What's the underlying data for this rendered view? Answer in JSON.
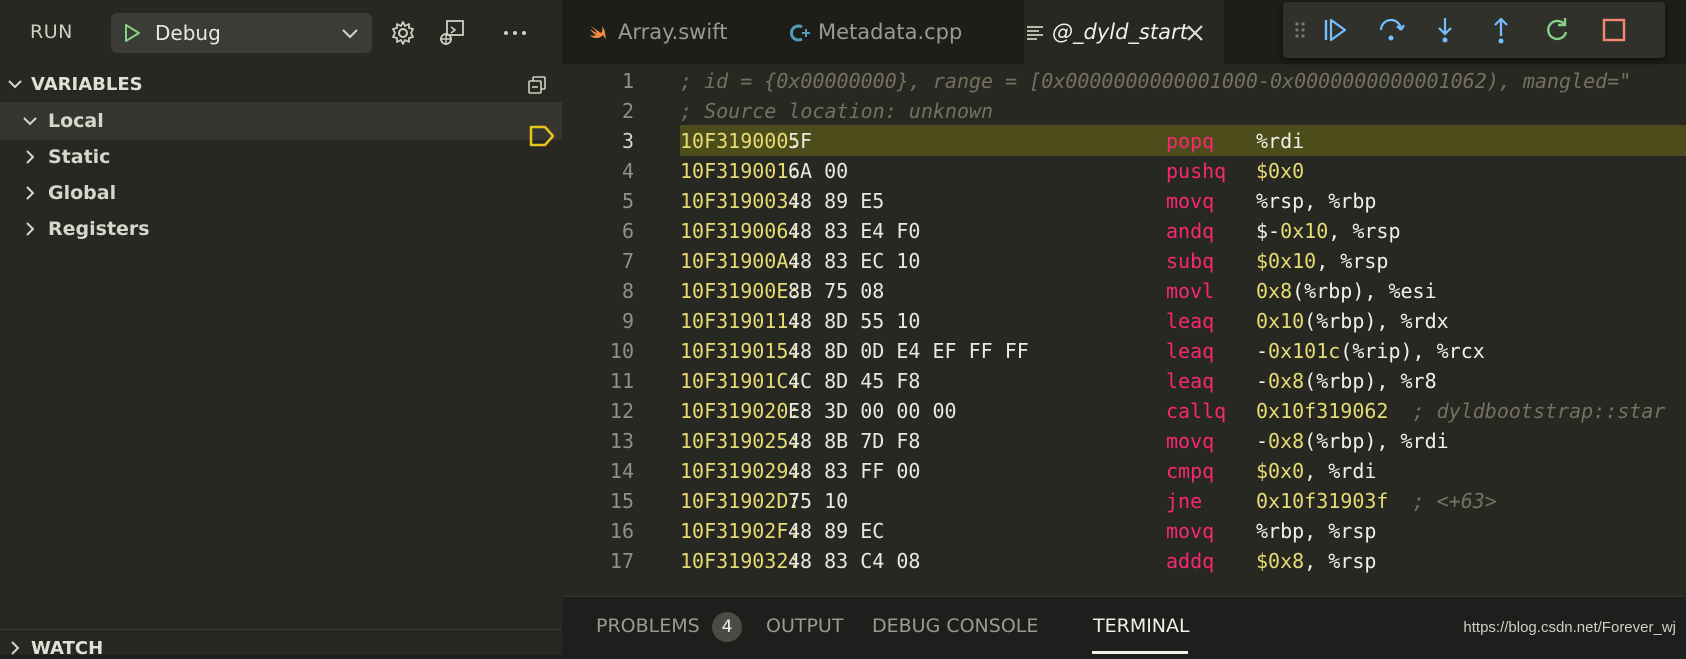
{
  "run": {
    "label": "RUN",
    "config": "Debug"
  },
  "variables": {
    "title": "VARIABLES",
    "items": [
      {
        "label": "Local",
        "expanded": true
      },
      {
        "label": "Static",
        "expanded": false
      },
      {
        "label": "Global",
        "expanded": false
      },
      {
        "label": "Registers",
        "expanded": false
      }
    ]
  },
  "watch": {
    "title": "WATCH"
  },
  "tabs": [
    {
      "label": "Array.swift",
      "icon": "swift-icon"
    },
    {
      "label": "Metadata.cpp",
      "icon": "cpp-icon"
    },
    {
      "label": "@_dyld_start",
      "icon": "disassembly-icon",
      "active": true
    }
  ],
  "debug_toolbar": [
    "continue-icon",
    "step-over-icon",
    "step-into-icon",
    "step-out-icon",
    "restart-icon",
    "stop-icon"
  ],
  "code": {
    "line1": "; id = {0x00000000}, range = [0x0000000000001000-0x0000000000001062), mangled=\"",
    "line2": "; Source location: unknown",
    "current_line": 3,
    "instructions": [
      {
        "n": "3",
        "addr": "10F319000:",
        "bytes": "5F",
        "op": "popq",
        "args": [
          {
            "t": "%rdi",
            "c": ""
          }
        ]
      },
      {
        "n": "4",
        "addr": "10F319001:",
        "bytes": "6A 00",
        "op": "pushq",
        "args": [
          {
            "t": "$0x0",
            "c": "lit"
          }
        ]
      },
      {
        "n": "5",
        "addr": "10F319003:",
        "bytes": "48 89 E5",
        "op": "movq",
        "args": [
          {
            "t": "%rsp, %rbp",
            "c": ""
          }
        ]
      },
      {
        "n": "6",
        "addr": "10F319006:",
        "bytes": "48 83 E4 F0",
        "op": "andq",
        "args": [
          {
            "t": "$-",
            "c": ""
          },
          {
            "t": "0x10",
            "c": "lit"
          },
          {
            "t": ", %rsp",
            "c": ""
          }
        ]
      },
      {
        "n": "7",
        "addr": "10F31900A:",
        "bytes": "48 83 EC 10",
        "op": "subq",
        "args": [
          {
            "t": "$0x10",
            "c": "lit"
          },
          {
            "t": ", %rsp",
            "c": ""
          }
        ]
      },
      {
        "n": "8",
        "addr": "10F31900E:",
        "bytes": "8B 75 08",
        "op": "movl",
        "args": [
          {
            "t": "0x8",
            "c": "lit"
          },
          {
            "t": "(%rbp), %esi",
            "c": ""
          }
        ]
      },
      {
        "n": "9",
        "addr": "10F319011:",
        "bytes": "48 8D 55 10",
        "op": "leaq",
        "args": [
          {
            "t": "0x10",
            "c": "lit"
          },
          {
            "t": "(%rbp), %rdx",
            "c": ""
          }
        ]
      },
      {
        "n": "10",
        "addr": "10F319015:",
        "bytes": "48 8D 0D E4 EF FF FF",
        "op": "leaq",
        "args": [
          {
            "t": "-",
            "c": ""
          },
          {
            "t": "0x101c",
            "c": "lit"
          },
          {
            "t": "(%rip), %rcx",
            "c": ""
          }
        ]
      },
      {
        "n": "11",
        "addr": "10F31901C:",
        "bytes": "4C 8D 45 F8",
        "op": "leaq",
        "args": [
          {
            "t": "-",
            "c": ""
          },
          {
            "t": "0x8",
            "c": "lit"
          },
          {
            "t": "(%rbp), %r8",
            "c": ""
          }
        ]
      },
      {
        "n": "12",
        "addr": "10F319020:",
        "bytes": "E8 3D 00 00 00",
        "op": "callq",
        "args": [
          {
            "t": "0x10f319062",
            "c": "lit"
          },
          {
            "t": "  ; dyldbootstrap::star",
            "c": "tcmt"
          }
        ]
      },
      {
        "n": "13",
        "addr": "10F319025:",
        "bytes": "48 8B 7D F8",
        "op": "movq",
        "args": [
          {
            "t": "-",
            "c": ""
          },
          {
            "t": "0x8",
            "c": "lit"
          },
          {
            "t": "(%rbp), %rdi",
            "c": ""
          }
        ]
      },
      {
        "n": "14",
        "addr": "10F319029:",
        "bytes": "48 83 FF 00",
        "op": "cmpq",
        "args": [
          {
            "t": "$0x0",
            "c": "lit"
          },
          {
            "t": ", %rdi",
            "c": ""
          }
        ]
      },
      {
        "n": "15",
        "addr": "10F31902D:",
        "bytes": "75 10",
        "op": "jne",
        "args": [
          {
            "t": "0x10f31903f",
            "c": "lit"
          },
          {
            "t": "  ; <+63>",
            "c": "tcmt"
          }
        ]
      },
      {
        "n": "16",
        "addr": "10F31902F:",
        "bytes": "48 89 EC",
        "op": "movq",
        "args": [
          {
            "t": "%rbp, %rsp",
            "c": ""
          }
        ]
      },
      {
        "n": "17",
        "addr": "10F319032:",
        "bytes": "48 83 C4 08",
        "op": "addq",
        "args": [
          {
            "t": "$0x8",
            "c": "lit"
          },
          {
            "t": ", %rsp",
            "c": ""
          }
        ]
      }
    ]
  },
  "panel": {
    "tabs": [
      "PROBLEMS",
      "OUTPUT",
      "DEBUG CONSOLE",
      "TERMINAL"
    ],
    "problems_count": "4",
    "active": "TERMINAL",
    "watermark": "https://blog.csdn.net/Forever_wj"
  }
}
